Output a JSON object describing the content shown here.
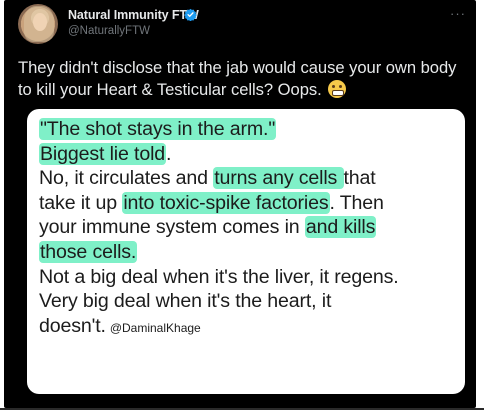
{
  "tweet": {
    "display_name": "Natural Immunity FTW",
    "handle": "@NaturallyFTW",
    "more": "···",
    "text": "They didn't disclose that the jab would cause your own body to kill your Heart & Testicular cells? Oops.",
    "emoji": "grimacing-face"
  },
  "media": {
    "line1": "\"The shot stays in the arm.\"",
    "line2_hl": "Biggest lie told",
    "line2_rest": ".",
    "line3_a": "No, it circulates and ",
    "line3_hl": "turns any cells ",
    "line3_b": "that",
    "line4_a": "take it up ",
    "line4_hl": "into toxic-spike factories",
    "line4_b": ". Then",
    "line5_a": "your immune system comes in ",
    "line5_hl": "and kills",
    "line6_hl": "those cells.",
    "line7": "Not a big deal when it's the liver, it regens.",
    "line8": "Very big deal when it's the heart, it",
    "line9": "doesn't.",
    "credit": "@DaminalKhage"
  },
  "colors": {
    "background": "#000000",
    "highlight": "#7ff0c8",
    "verified": "#1d9bf0"
  }
}
